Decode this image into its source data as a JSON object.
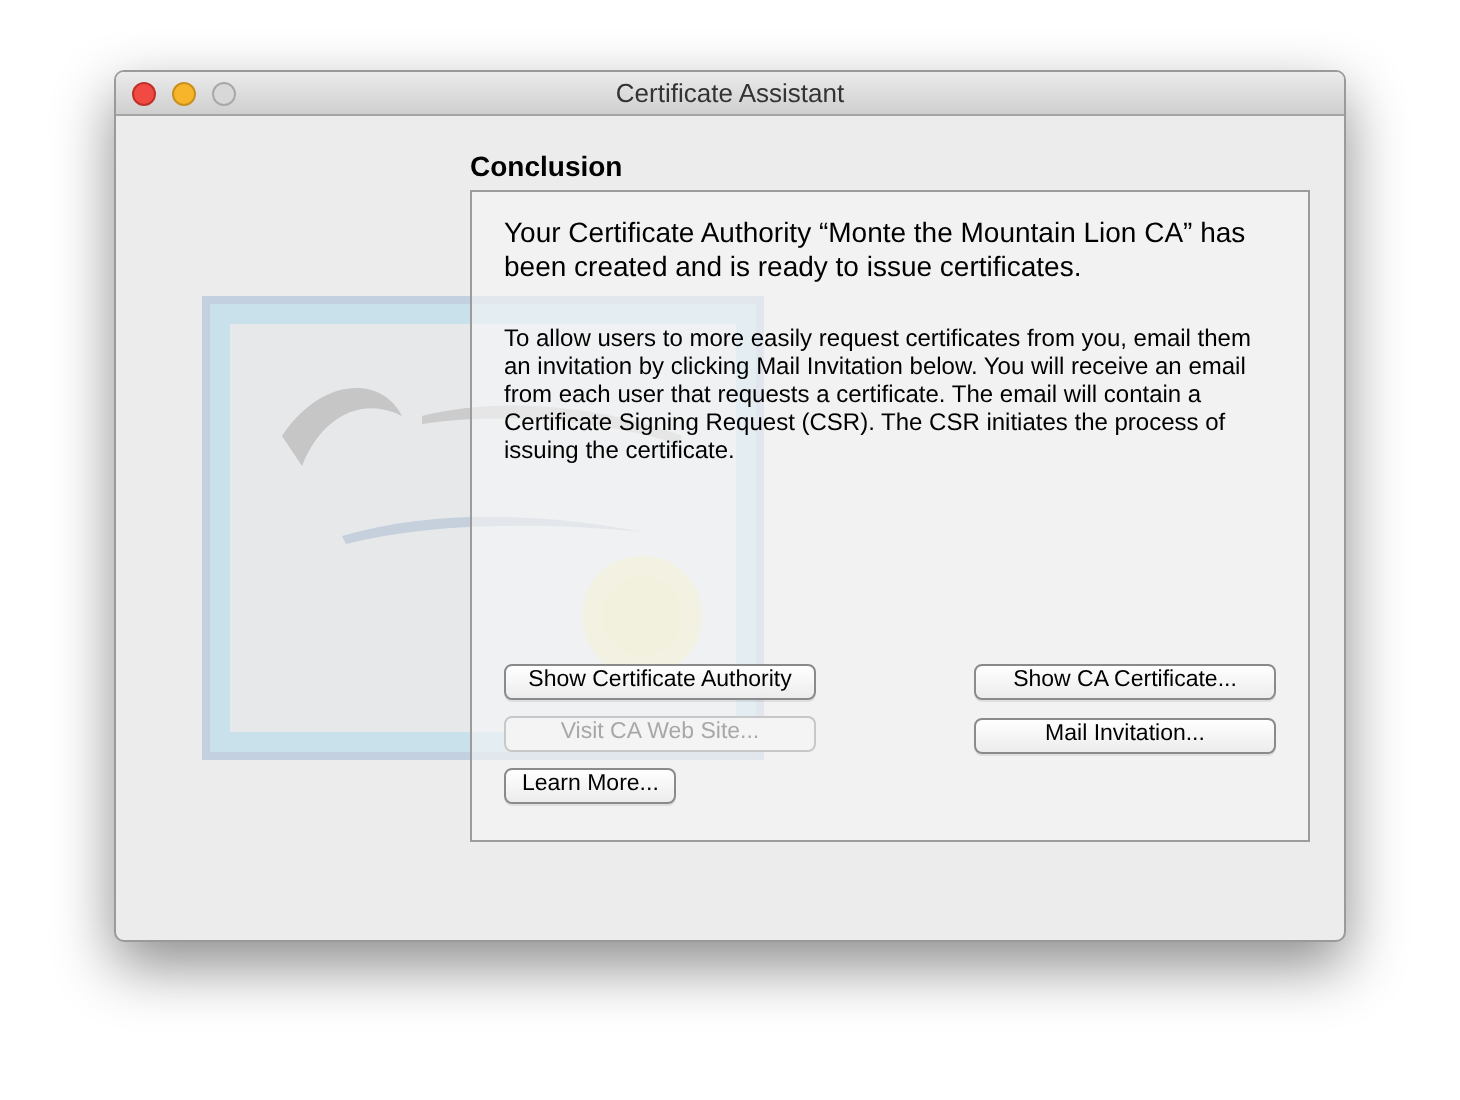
{
  "window": {
    "title": "Certificate Assistant"
  },
  "heading": "Conclusion",
  "panel": {
    "message": "Your Certificate Authority “Monte the Mountain Lion CA” has been created and is ready to issue certificates.",
    "description": "To allow users to more easily request certificates from you, email them an invitation by clicking Mail Invitation below. You will receive an email from each user that requests a certificate. The email will contain a Certificate Signing Request (CSR). The CSR initiates the process of issuing the certificate.",
    "left_buttons": [
      {
        "label": "Show Certificate Authority",
        "disabled": false
      },
      {
        "label": "Visit CA Web Site...",
        "disabled": true
      },
      {
        "label": "Learn More...",
        "disabled": false
      }
    ],
    "right_buttons": [
      {
        "label": "Show CA Certificate...",
        "disabled": false
      },
      {
        "label": "Mail Invitation...",
        "disabled": false
      }
    ]
  }
}
